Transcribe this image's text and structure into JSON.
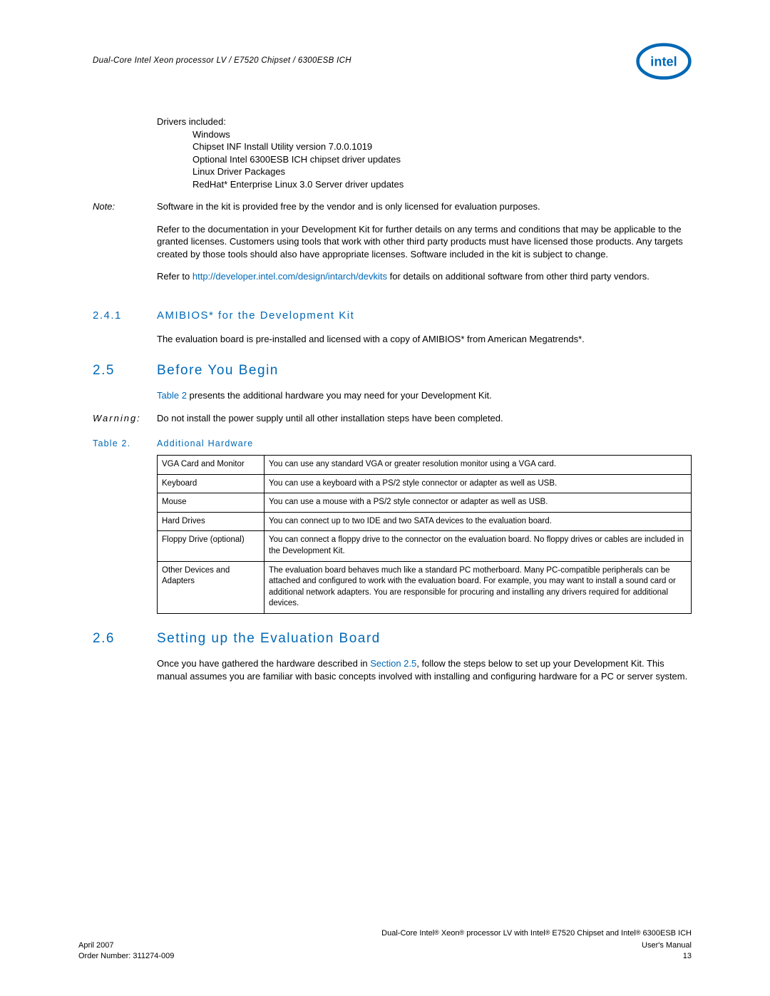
{
  "header": {
    "breadcrumb": "Dual-Core Intel Xeon processor LV / E7520 Chipset / 6300ESB ICH"
  },
  "drivers": {
    "intro": "Drivers included:",
    "items": [
      "Windows",
      "Chipset INF Install Utility version 7.0.0.1019",
      "Optional Intel 6300ESB ICH chipset driver updates",
      "Linux Driver Packages",
      "RedHat* Enterprise Linux 3.0 Server driver updates"
    ]
  },
  "note": {
    "label": "Note:",
    "p1": "Software in the kit is provided free by the vendor and is only licensed for evaluation purposes.",
    "p2": "Refer to the documentation in your Development Kit for further details on any terms and conditions that may be applicable to the granted licenses. Customers using tools that work with other third party products must have licensed those products. Any targets created by those tools should also have appropriate licenses. Software included in the kit is subject to change.",
    "p3_pre": "Refer to ",
    "p3_link": "http://developer.intel.com/design/intarch/devkits",
    "p3_post": " for details on additional software from other third party vendors."
  },
  "s241": {
    "num": "2.4.1",
    "title": "AMIBIOS* for the Development Kit",
    "body": "The evaluation board is pre-installed and licensed with a copy of AMIBIOS* from American Megatrends*."
  },
  "s25": {
    "num": "2.5",
    "title": "Before You Begin",
    "body_pre": "",
    "body_link": "Table 2",
    "body_post": " presents the additional hardware you may need for your Development Kit."
  },
  "warning": {
    "label": "Warning:",
    "body": "Do not install the power supply until all other installation steps have been completed."
  },
  "table2": {
    "caption_label": "Table 2.",
    "caption_title": "Additional Hardware",
    "rows": [
      [
        "VGA Card and Monitor",
        "You can use any standard VGA or greater resolution monitor using a VGA card."
      ],
      [
        "Keyboard",
        "You can use a keyboard with a PS/2 style connector or adapter as well as USB."
      ],
      [
        "Mouse",
        "You can use a mouse with a PS/2 style connector or adapter as well as USB."
      ],
      [
        "Hard Drives",
        "You can connect up to two IDE and two SATA devices to the evaluation board."
      ],
      [
        "Floppy Drive (optional)",
        "You can connect a floppy drive to the connector on the evaluation board. No floppy drives or cables are included in the Development Kit."
      ],
      [
        "Other Devices and Adapters",
        "The evaluation board behaves much like a standard PC motherboard. Many PC-compatible peripherals can be attached and configured to work with the evaluation board. For example, you may want to install a sound card or additional network adapters. You are responsible for procuring and installing any drivers required for additional devices."
      ]
    ]
  },
  "s26": {
    "num": "2.6",
    "title": "Setting up the Evaluation Board",
    "body_pre": "Once you have gathered the hardware described in ",
    "body_link": "Section 2.5",
    "body_post": ", follow the steps below to set up your Development Kit. This manual assumes you are familiar with basic concepts involved with installing and configuring hardware for a PC or server system."
  },
  "footer": {
    "product_1": "Dual-Core Intel",
    "product_2": " Xeon",
    "product_3": " processor LV with Intel",
    "product_4": " E7520 Chipset and Intel",
    "product_5": " 6300ESB ICH",
    "date": "April 2007",
    "manual": "User's Manual",
    "order": "Order Number: 311274-009",
    "page": "13"
  }
}
